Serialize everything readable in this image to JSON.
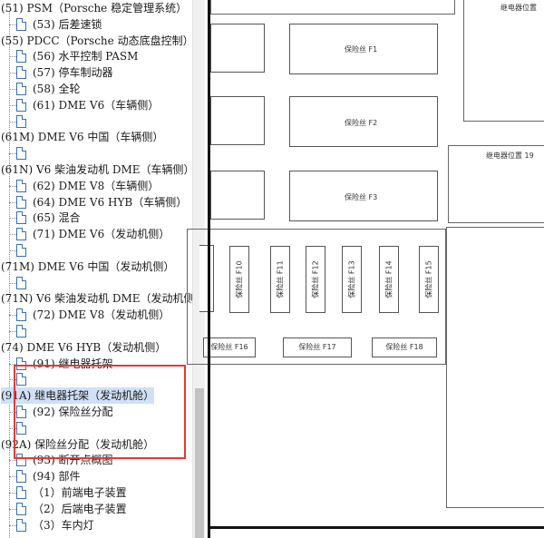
{
  "tree": [
    {
      "text": "(51) PSM（Porsche 稳定管理系统）",
      "level": 0
    },
    {
      "text": "(53) 后差速锁",
      "level": 1
    },
    {
      "text": "(55) PDCC（Porsche 动态底盘控制）",
      "level": 0
    },
    {
      "text": "(56) 水平控制 PASM",
      "level": 1
    },
    {
      "text": "(57) 停车制动器",
      "level": 1
    },
    {
      "text": "(58) 全轮",
      "level": 1
    },
    {
      "text": "(61) DME V6（车辆侧）",
      "level": 1
    },
    {
      "text": "",
      "level": 1
    },
    {
      "text": "(61M) DME V6 中国（车辆侧）",
      "level": 0
    },
    {
      "text": "",
      "level": 1
    },
    {
      "text": "(61N) V6 柴油发动机 DME（车辆侧）",
      "level": 0
    },
    {
      "text": "(62) DME V8（车辆侧）",
      "level": 1
    },
    {
      "text": "(64) DME V6 HYB（车辆侧）",
      "level": 1
    },
    {
      "text": "(65) 混合",
      "level": 1
    },
    {
      "text": "(71) DME V6（发动机侧）",
      "level": 1
    },
    {
      "text": "",
      "level": 1
    },
    {
      "text": "(71M) DME V6 中国（发动机侧）",
      "level": 0
    },
    {
      "text": "",
      "level": 1
    },
    {
      "text": "(71N) V6 柴油发动机 DME（发动机侧",
      "level": 0
    },
    {
      "text": "(72) DME V8（发动机侧）",
      "level": 1
    },
    {
      "text": "",
      "level": 1
    },
    {
      "text": "(74) DME V6 HYB（发动机侧）",
      "level": 0
    },
    {
      "text": "(91) 继电器托架",
      "level": 1
    },
    {
      "text": "",
      "level": 1
    },
    {
      "text": "(91A) 继电器托架（发动机舱）",
      "level": 0,
      "selected": true
    },
    {
      "text": "(92) 保险丝分配",
      "level": 1
    },
    {
      "text": "",
      "level": 1
    },
    {
      "text": "(92A) 保险丝分配（发动机舱）",
      "level": 0
    },
    {
      "text": "(93) 断开点概图",
      "level": 1
    },
    {
      "text": "(94) 部件",
      "level": 1
    },
    {
      "text": "（1）前端电子装置",
      "level": 1
    },
    {
      "text": "（2）后端电子装置",
      "level": 1
    },
    {
      "text": "（3）车内灯",
      "level": 1
    }
  ],
  "diagram": {
    "relay_top": "继电器位置",
    "relay_19": "继电器位置 19",
    "fuse_f1": "保险丝 F1",
    "fuse_f2": "保险丝 F2",
    "fuse_f3": "保险丝 F3",
    "fuse_f10": "保险丝 F10",
    "fuse_f11": "保险丝 F11",
    "fuse_f12": "保险丝 F12",
    "fuse_f13": "保险丝 F13",
    "fuse_f14": "保险丝 F14",
    "fuse_f15": "保险丝 F15",
    "fuse_f16": "保险丝 F16",
    "fuse_f17": "保险丝 F17",
    "fuse_f18": "保险丝 F18"
  }
}
